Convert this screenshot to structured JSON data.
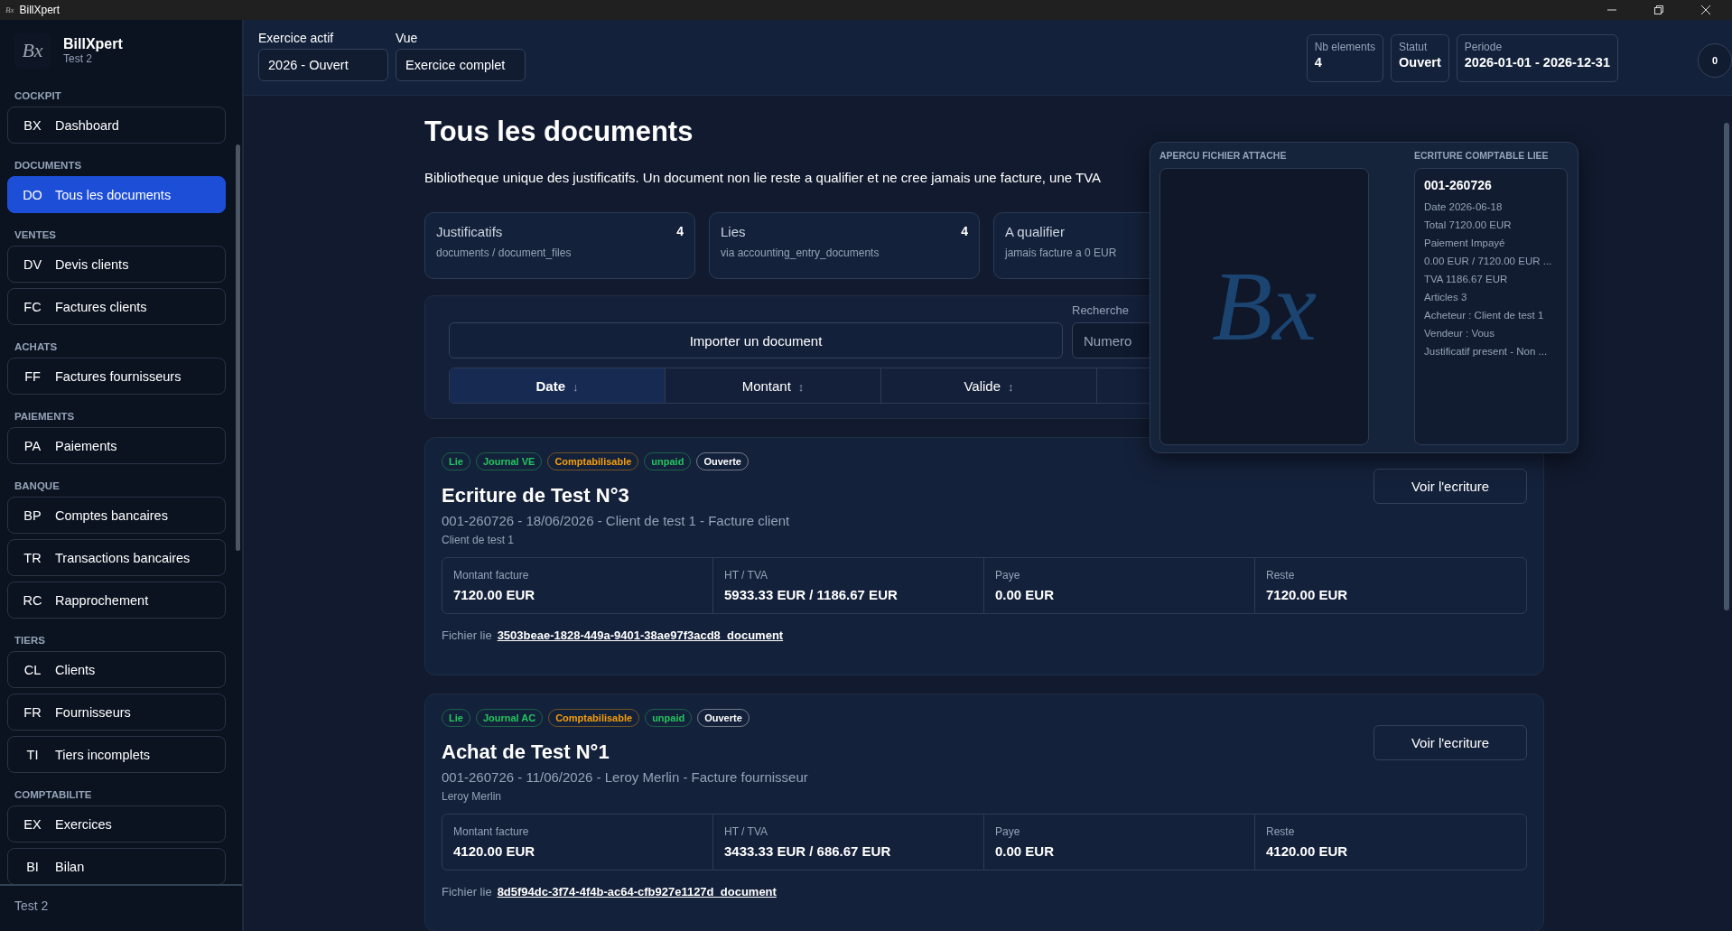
{
  "window": {
    "logo": "Bx",
    "title": "BillXpert"
  },
  "sidebar": {
    "logo": "Bx",
    "app_name": "BillXpert",
    "subtitle": "Test 2",
    "footer": "Test 2",
    "sections": [
      {
        "label": "COCKPIT",
        "items": [
          {
            "code": "BX",
            "label": "Dashboard",
            "selected": false
          }
        ]
      },
      {
        "label": "DOCUMENTS",
        "items": [
          {
            "code": "DO",
            "label": "Tous les documents",
            "selected": true
          }
        ]
      },
      {
        "label": "VENTES",
        "items": [
          {
            "code": "DV",
            "label": "Devis clients",
            "selected": false
          },
          {
            "code": "FC",
            "label": "Factures clients",
            "selected": false
          }
        ]
      },
      {
        "label": "ACHATS",
        "items": [
          {
            "code": "FF",
            "label": "Factures fournisseurs",
            "selected": false
          }
        ]
      },
      {
        "label": "PAIEMENTS",
        "items": [
          {
            "code": "PA",
            "label": "Paiements",
            "selected": false
          }
        ]
      },
      {
        "label": "BANQUE",
        "items": [
          {
            "code": "BP",
            "label": "Comptes bancaires",
            "selected": false
          },
          {
            "code": "TR",
            "label": "Transactions bancaires",
            "selected": false
          },
          {
            "code": "RC",
            "label": "Rapprochement",
            "selected": false
          }
        ]
      },
      {
        "label": "TIERS",
        "items": [
          {
            "code": "CL",
            "label": "Clients",
            "selected": false
          },
          {
            "code": "FR",
            "label": "Fournisseurs",
            "selected": false
          },
          {
            "code": "TI",
            "label": "Tiers incomplets",
            "selected": false
          }
        ]
      },
      {
        "label": "COMPTABILITE",
        "items": [
          {
            "code": "EX",
            "label": "Exercices",
            "selected": false
          },
          {
            "code": "BI",
            "label": "Bilan",
            "selected": false
          }
        ]
      }
    ]
  },
  "header": {
    "selects": [
      {
        "label": "Exercice actif",
        "value": "2026 - Ouvert"
      },
      {
        "label": "Vue",
        "value": "Exercice complet"
      }
    ],
    "stats": [
      {
        "label": "Nb elements",
        "value": "4"
      },
      {
        "label": "Statut",
        "value": "Ouvert"
      },
      {
        "label": "Periode",
        "value": "2026-01-01 - 2026-12-31"
      }
    ],
    "badge": "0"
  },
  "page": {
    "title": "Tous les documents",
    "description": "Bibliotheque unique des justificatifs. Un document non lie reste a qualifier et ne cree jamais une facture, une TVA",
    "stat_cards": [
      {
        "label": "Justificatifs",
        "count": "4",
        "hint": "documents / document_files"
      },
      {
        "label": "Lies",
        "count": "4",
        "hint": "via accounting_entry_documents"
      },
      {
        "label": "A qualifier",
        "hint": "jamais facture a 0 EUR"
      }
    ],
    "import_button": "Importer un document",
    "search": {
      "label": "Recherche",
      "placeholder": "Numero"
    },
    "sort_tabs": [
      {
        "label": "Date",
        "arrow": "↓",
        "selected": true
      },
      {
        "label": "Montant",
        "arrow": "↕",
        "selected": false
      },
      {
        "label": "Valide",
        "arrow": "↕",
        "selected": false
      }
    ],
    "documents": [
      {
        "chips": [
          {
            "label": "Lie",
            "color": "#22c55e"
          },
          {
            "label": "Journal VE",
            "color": "#22c55e"
          },
          {
            "label": "Comptabilisable",
            "color": "#f59e0b"
          },
          {
            "label": "unpaid",
            "color": "#22c55e"
          },
          {
            "label": "Ouverte",
            "color": "#ffffff"
          }
        ],
        "button": "Voir l'ecriture",
        "title": "Ecriture de Test N°3",
        "meta": "001-260726 - 18/06/2026 - Client de test 1 - Facture client",
        "party": "Client de test 1",
        "amounts": [
          {
            "label": "Montant facture",
            "value": "7120.00 EUR"
          },
          {
            "label": "HT / TVA",
            "value": "5933.33 EUR / 1186.67 EUR"
          },
          {
            "label": "Paye",
            "value": "0.00 EUR"
          },
          {
            "label": "Reste",
            "value": "7120.00 EUR"
          }
        ],
        "file_label": "Fichier lie",
        "file": "3503beae-1828-449a-9401-38ae97f3acd8_document"
      },
      {
        "chips": [
          {
            "label": "Lie",
            "color": "#22c55e"
          },
          {
            "label": "Journal AC",
            "color": "#22c55e"
          },
          {
            "label": "Comptabilisable",
            "color": "#f59e0b"
          },
          {
            "label": "unpaid",
            "color": "#22c55e"
          },
          {
            "label": "Ouverte",
            "color": "#ffffff"
          }
        ],
        "button": "Voir l'ecriture",
        "title": "Achat de Test N°1",
        "meta": "001-260726 - 11/06/2026 - Leroy Merlin - Facture fournisseur",
        "party": "Leroy Merlin",
        "amounts": [
          {
            "label": "Montant facture",
            "value": "4120.00 EUR"
          },
          {
            "label": "HT / TVA",
            "value": "3433.33 EUR / 686.67 EUR"
          },
          {
            "label": "Paye",
            "value": "0.00 EUR"
          },
          {
            "label": "Reste",
            "value": "4120.00 EUR"
          }
        ],
        "file_label": "Fichier lie",
        "file": "8d5f94dc-3f74-4f4b-ac64-cfb927e1127d_document"
      }
    ]
  },
  "popup": {
    "preview_title": "APERCU FICHIER ATTACHE",
    "preview_logo": "Bx",
    "entry_title": "ECRITURE COMPTABLE LIEE",
    "entry_number": "001-260726",
    "entry_lines": [
      "Date 2026-06-18",
      "Total 7120.00 EUR",
      "Paiement Impayé",
      "0.00 EUR / 7120.00 EUR ...",
      "TVA 1186.67 EUR",
      "Articles 3",
      "Acheteur : Client de test 1",
      "Vendeur : Vous",
      "Justificatif present - Non ..."
    ]
  }
}
